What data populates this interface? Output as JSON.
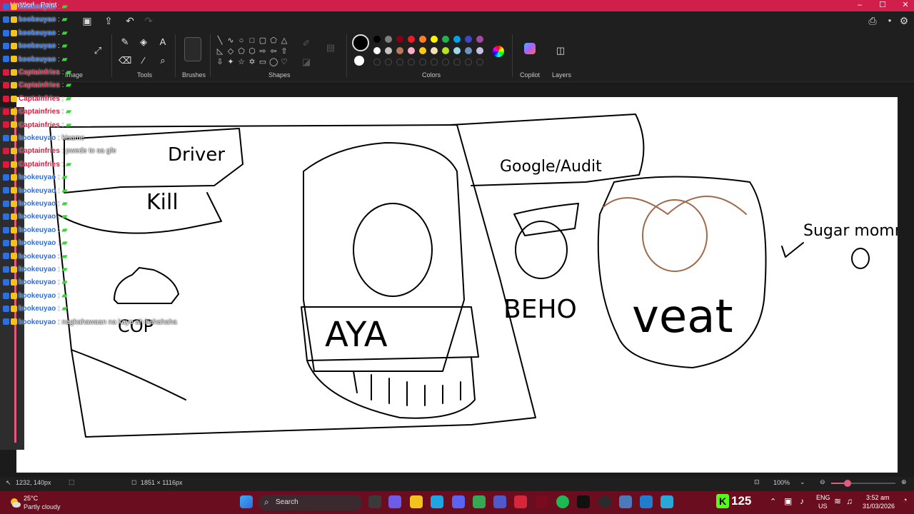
{
  "window": {
    "title": "Untitled - Paint"
  },
  "ribbon": {
    "groups": {
      "image": "Image",
      "tools": "Tools",
      "brushes": "Brushes",
      "shapes": "Shapes",
      "colors": "Colors",
      "copilot": "Copilot",
      "layers": "Layers"
    },
    "palette": [
      "#000000",
      "#7f7f7f",
      "#880015",
      "#ed1c24",
      "#ff7f27",
      "#fff200",
      "#22b14c",
      "#00a2e8",
      "#3f48cc",
      "#a349a4",
      "#ffffff",
      "#c3c3c3",
      "#b97a57",
      "#ffaec9",
      "#ffc90e",
      "#efe4b0",
      "#b5e61d",
      "#99d9ea",
      "#7092be",
      "#c8bfe7"
    ],
    "primary_color": "#000000",
    "secondary_color": "#ffffff"
  },
  "status": {
    "cursor_pos": "1232, 140px",
    "canvas_size": "1851 × 1116px",
    "zoom": "100%",
    "zoom_fraction": 0.25
  },
  "taskbar": {
    "weather_temp": "25°C",
    "weather_desc": "Partly cloudy",
    "search_placeholder": "Search",
    "kick_count": "125",
    "lang_top": "ENG",
    "lang_bottom": "US",
    "time": "3:52 am",
    "date": "31/03/2026"
  },
  "chat": [
    {
      "user": "kookeuyao",
      "msg": "",
      "color": "blue"
    },
    {
      "user": "kookeuyao",
      "msg": "",
      "color": "blue"
    },
    {
      "user": "kookeuyao",
      "msg": "",
      "color": "blue"
    },
    {
      "user": "kookeuyao",
      "msg": "",
      "color": "blue"
    },
    {
      "user": "kookeuyao",
      "msg": "",
      "color": "blue"
    },
    {
      "user": "Captainfries",
      "msg": "",
      "color": "red"
    },
    {
      "user": "Captainfries",
      "msg": "",
      "color": "red"
    },
    {
      "user": "Captainfries",
      "msg": "",
      "color": "red"
    },
    {
      "user": "Captainfries",
      "msg": "",
      "color": "red"
    },
    {
      "user": "Captainfries",
      "msg": "",
      "color": "red"
    },
    {
      "user": "kookeuyao",
      "msg": "kisame",
      "color": "blue"
    },
    {
      "user": "Captainfries",
      "msg": "pwede to sa gfe",
      "color": "red"
    },
    {
      "user": "Captainfries",
      "msg": "",
      "color": "red"
    },
    {
      "user": "kookeuyao",
      "msg": "",
      "color": "blue"
    },
    {
      "user": "kookeuyao",
      "msg": "",
      "color": "blue"
    },
    {
      "user": "kookeuyao",
      "msg": "",
      "color": "blue"
    },
    {
      "user": "kookeuyao",
      "msg": "",
      "color": "blue"
    },
    {
      "user": "kookeuyao",
      "msg": "",
      "color": "blue"
    },
    {
      "user": "kookeuyao",
      "msg": "",
      "color": "blue"
    },
    {
      "user": "kookeuyao",
      "msg": "",
      "color": "blue"
    },
    {
      "user": "kookeuyao",
      "msg": "",
      "color": "blue"
    },
    {
      "user": "kookeuyao",
      "msg": "",
      "color": "blue"
    },
    {
      "user": "kookeuyao",
      "msg": "",
      "color": "blue"
    },
    {
      "user": "kookeuyao",
      "msg": "",
      "color": "blue"
    },
    {
      "user": "kookeuyao",
      "msg": "nagkahawaan na kayo ah hahahaha",
      "color": "blue"
    }
  ],
  "drawing": {
    "texts": [
      "Driver",
      "Kill",
      "Sugar mommy",
      "BEHO",
      "veat",
      "AYA",
      "COP",
      "Google/Audit"
    ]
  }
}
